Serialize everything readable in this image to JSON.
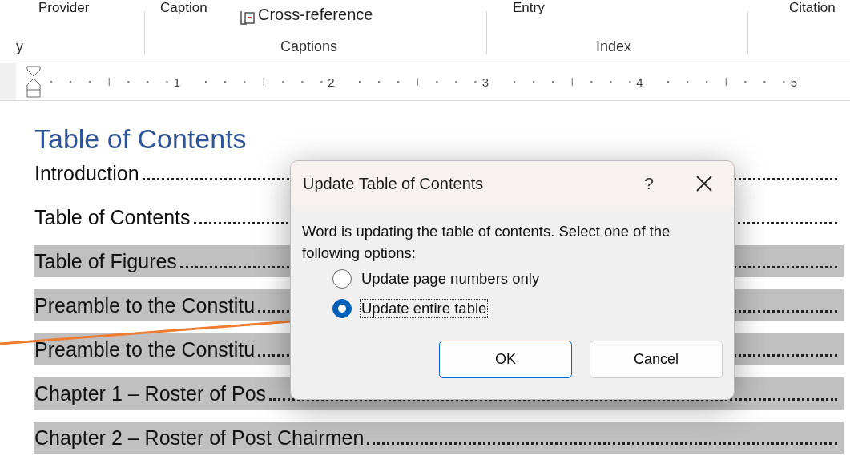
{
  "ribbon": {
    "top_row": [
      {
        "label": "Provider"
      },
      {
        "label": "Caption"
      },
      {
        "label": "Cross-reference",
        "kind": "crossref"
      },
      {
        "label": "Entry"
      },
      {
        "label": "Citation"
      }
    ],
    "groups": [
      "y",
      "Captions",
      "Index"
    ]
  },
  "ruler": {
    "numbers": [
      "1",
      "2",
      "3",
      "4",
      "5"
    ]
  },
  "document": {
    "heading": "Table of Contents",
    "entries": [
      {
        "text": "Introduction",
        "highlighted": false
      },
      {
        "text": "Table of Contents",
        "highlighted": false
      },
      {
        "text": "Table of Figures",
        "highlighted": true
      },
      {
        "text": "Preamble to the Constitu",
        "highlighted": true
      },
      {
        "text": "Preamble to the Constitu",
        "highlighted": true
      },
      {
        "text": "Chapter 1 – Roster of Pos",
        "highlighted": true
      },
      {
        "text": "Chapter 2 – Roster of Post Chairmen",
        "highlighted": true
      }
    ]
  },
  "dialog": {
    "title": "Update Table of Contents",
    "help": "?",
    "message": "Word is updating the table of contents.  Select one of the following options:",
    "options": [
      {
        "label": "Update page numbers only",
        "selected": false
      },
      {
        "label": "Update entire table",
        "selected": true
      }
    ],
    "buttons": [
      {
        "label": "OK",
        "default": true
      },
      {
        "label": "Cancel",
        "default": false
      }
    ]
  }
}
